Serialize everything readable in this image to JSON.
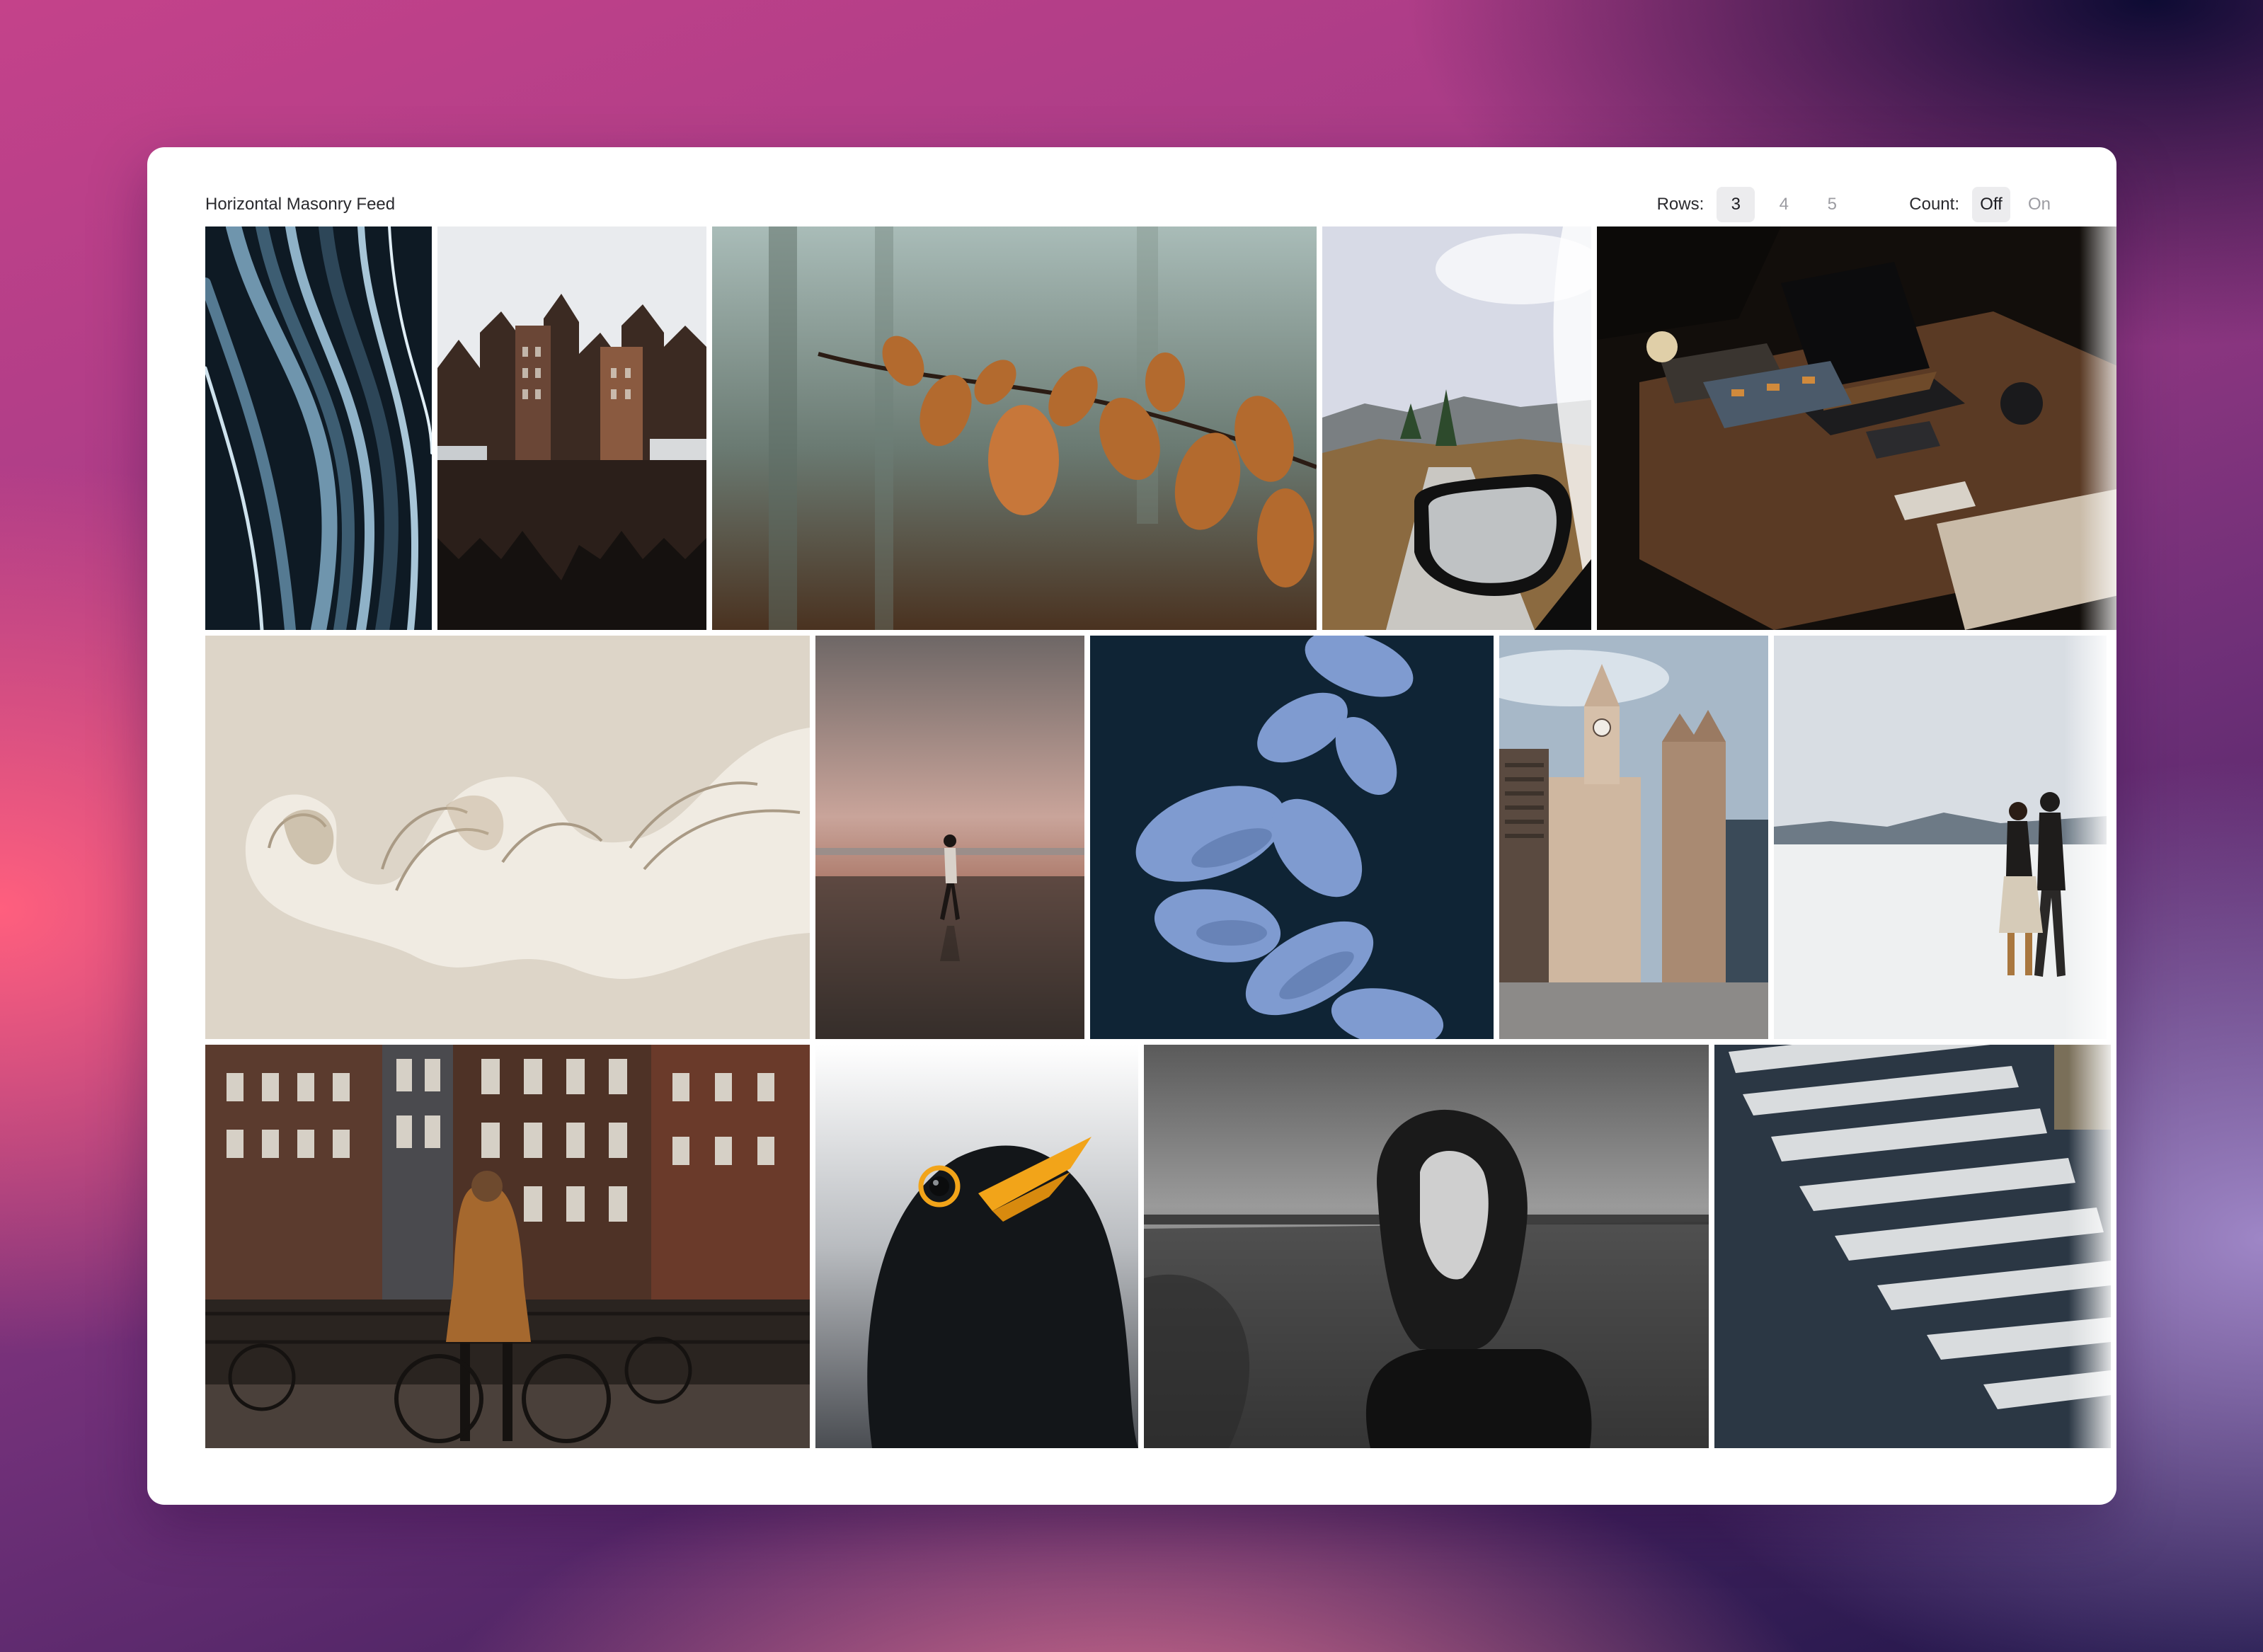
{
  "app": {
    "title": "Horizontal Masonry Feed"
  },
  "controls": {
    "rows": {
      "label": "Rows:",
      "options": [
        "3",
        "4",
        "5"
      ],
      "selected": "3"
    },
    "count": {
      "label": "Count:",
      "options": [
        "Off",
        "On"
      ],
      "selected": "Off"
    }
  },
  "feed": {
    "rows": [
      {
        "images": [
          {
            "subject": "abstract-blue-curves"
          },
          {
            "subject": "amsterdam-canal-houses"
          },
          {
            "subject": "autumn-leaves-branch"
          },
          {
            "subject": "car-mirror-mountain-road"
          },
          {
            "subject": "desk-laptop-keyboard"
          }
        ]
      },
      {
        "images": [
          {
            "subject": "cream-paper-sculpture"
          },
          {
            "subject": "person-walking-beach-sunset"
          },
          {
            "subject": "blue-fabric-leaves"
          },
          {
            "subject": "clock-tower-city"
          },
          {
            "subject": "couple-salt-flats"
          }
        ]
      },
      {
        "images": [
          {
            "subject": "woman-bicycle-amsterdam"
          },
          {
            "subject": "blackbird-yellow-beak"
          },
          {
            "subject": "woman-black-white-portrait"
          },
          {
            "subject": "crosswalk-street"
          }
        ]
      }
    ]
  },
  "colors": {
    "card_bg": "#ffffff",
    "active_option_bg": "#ececee",
    "inactive_option_text": "#9c9ca2",
    "text": "#2a2a2e"
  }
}
